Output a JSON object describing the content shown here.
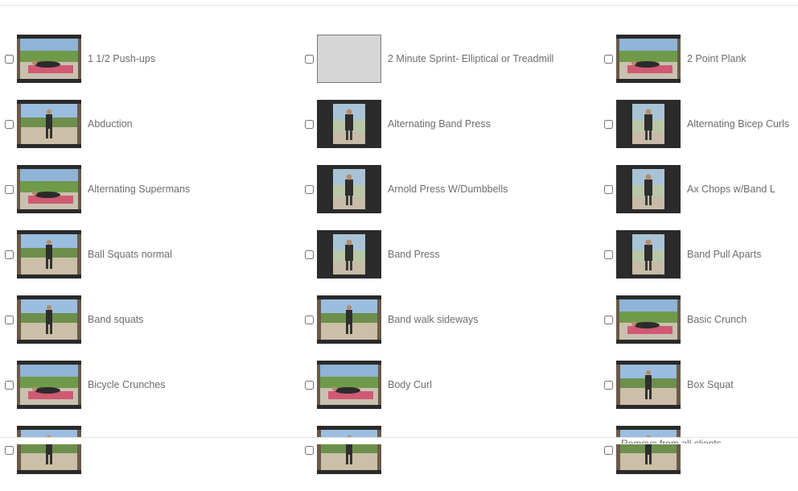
{
  "rows": [
    [
      {
        "label": "1 1/2 Push-ups",
        "thumb": "outdoor-mat"
      },
      {
        "label": "2 Minute Sprint- Elliptical or Treadmill",
        "thumb": "blank"
      },
      {
        "label": "2 Point Plank",
        "thumb": "outdoor-mat"
      }
    ],
    [
      {
        "label": "Abduction",
        "thumb": "outdoor-standing"
      },
      {
        "label": "Alternating Band Press",
        "thumb": "indoor-portrait"
      },
      {
        "label": "Alternating Bicep Curls",
        "thumb": "indoor-portrait"
      }
    ],
    [
      {
        "label": "Alternating Supermans",
        "thumb": "outdoor-mat"
      },
      {
        "label": "Arnold Press W/Dumbbells",
        "thumb": "indoor-portrait"
      },
      {
        "label": "Ax Chops w/Band L",
        "thumb": "indoor-portrait"
      }
    ],
    [
      {
        "label": "Ball Squats normal",
        "thumb": "outdoor-standing"
      },
      {
        "label": "Band Press",
        "thumb": "indoor-portrait"
      },
      {
        "label": "Band Pull Aparts",
        "thumb": "indoor-portrait"
      }
    ],
    [
      {
        "label": "Band squats",
        "thumb": "outdoor-standing"
      },
      {
        "label": "Band walk sideways",
        "thumb": "outdoor-standing"
      },
      {
        "label": "Basic Crunch",
        "thumb": "outdoor-mat"
      }
    ],
    [
      {
        "label": "Bicycle Crunches",
        "thumb": "outdoor-mat"
      },
      {
        "label": "Body Curl",
        "thumb": "outdoor-mat"
      },
      {
        "label": "Box Squat",
        "thumb": "outdoor-standing"
      }
    ],
    [
      {
        "label": "",
        "thumb": "outdoor-standing"
      },
      {
        "label": "",
        "thumb": "outdoor-standing"
      },
      {
        "label": "",
        "thumb": "outdoor-standing"
      }
    ]
  ],
  "bottom_cut_text": "Remove from all clients"
}
